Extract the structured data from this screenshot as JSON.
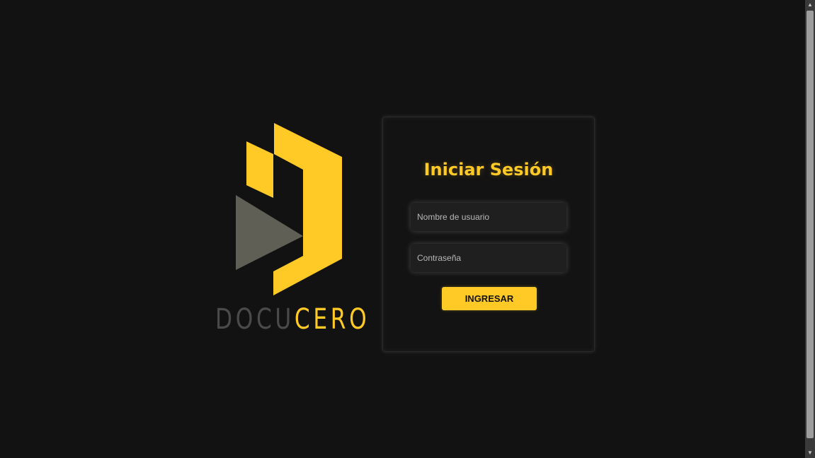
{
  "brand": {
    "name_part1": "DOCU",
    "name_part2": "CERO",
    "primary_color": "#ffc926",
    "secondary_color": "#5f5f55",
    "text_dark_color": "#4a4a4a"
  },
  "login": {
    "title": "Iniciar Sesión",
    "username_placeholder": "Nombre de usuario",
    "password_placeholder": "Contraseña",
    "submit_label": "INGRESAR"
  },
  "colors": {
    "background": "#121212",
    "accent": "#ffc926",
    "field_background": "#1f1f1f"
  },
  "icons": {
    "scroll_up": "triangle-up-icon",
    "scroll_down": "triangle-down-icon"
  }
}
